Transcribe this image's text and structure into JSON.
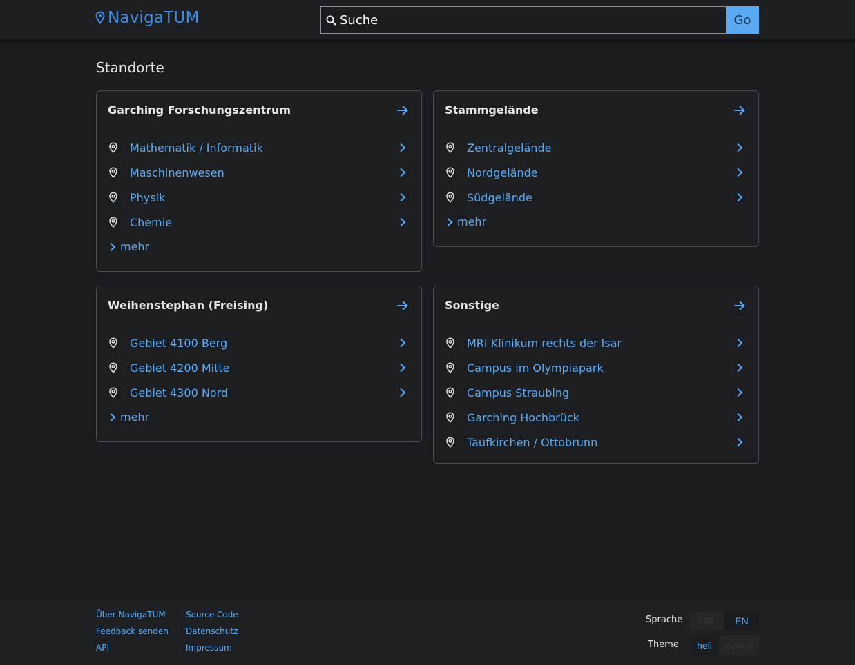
{
  "header": {
    "logo_text": "NavigaTUM",
    "search_placeholder": "Suche",
    "go_label": "Go"
  },
  "main": {
    "title": "Standorte",
    "more_label": "mehr",
    "cards": [
      {
        "title": "Garching Forschungszentrum",
        "items": [
          "Mathematik / Informatik",
          "Maschinenwesen",
          "Physik",
          "Chemie"
        ],
        "has_more": true
      },
      {
        "title": "Stammgelände",
        "items": [
          "Zentralgelände",
          "Nordgelände",
          "Südgelände"
        ],
        "has_more": true
      },
      {
        "title": "Weihenstephan (Freising)",
        "items": [
          "Gebiet 4100 Berg",
          "Gebiet 4200 Mitte",
          "Gebiet 4300 Nord"
        ],
        "has_more": true
      },
      {
        "title": "Sonstige",
        "items": [
          "MRI Klinikum rechts der Isar",
          "Campus im Olympiapark",
          "Campus Straubing",
          "Garching Hochbrück",
          "Taufkirchen / Ottobrunn"
        ],
        "has_more": false
      }
    ]
  },
  "footer": {
    "links_col1": [
      "Über NavigaTUM",
      "Feedback senden",
      "API"
    ],
    "links_col2": [
      "Source Code",
      "Datenschutz",
      "Impressum"
    ],
    "language_label": "Sprache",
    "language_options": [
      "DE",
      "EN"
    ],
    "language_selected": "EN",
    "theme_label": "Theme",
    "theme_options": [
      "hell",
      "dunkel"
    ],
    "theme_selected": "dunkel"
  },
  "colors": {
    "accent": "#5aa9f2",
    "logo": "#3b8ee8",
    "background": "#1b1c1f"
  },
  "icons": [
    "map-pin-icon",
    "search-icon",
    "arrow-right-icon",
    "chevron-right-icon"
  ]
}
